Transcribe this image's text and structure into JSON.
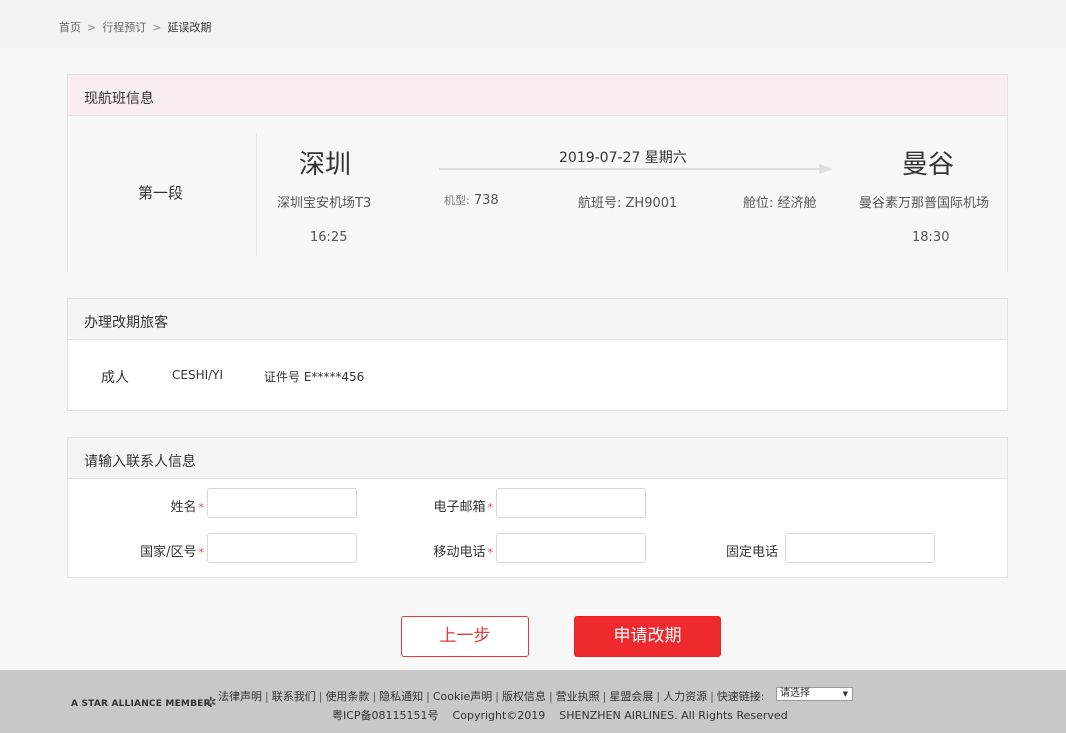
{
  "breadcrumb": {
    "home": "首页",
    "booking": "行程预订",
    "current": "延误改期",
    "sep": ">"
  },
  "flight_section": {
    "title": "现航班信息",
    "segment": "第一段",
    "origin": {
      "city": "深圳",
      "airport": "深圳宝安机场T3",
      "time": "16:25"
    },
    "destination": {
      "city": "曼谷",
      "airport": "曼谷素万那普国际机场",
      "time": "18:30"
    },
    "date": "2019-07-27 星期六",
    "aircraft_label": "机型:",
    "aircraft": "738",
    "flight_no_label": "航班号:",
    "flight_no": "ZH9001",
    "cabin_label": "舱位:",
    "cabin": "经济舱"
  },
  "passenger_section": {
    "title": "办理改期旅客",
    "type": "成人",
    "name": "CESHI/YI",
    "id": "证件号 E*****456"
  },
  "contact_section": {
    "title": "请输入联系人信息",
    "name_label": "姓名",
    "email_label": "电子邮箱",
    "country_label": "国家/区号",
    "mobile_label": "移动电话",
    "landline_label": "固定电话",
    "required_mark": "*"
  },
  "actions": {
    "prev": "上一步",
    "submit": "申请改期"
  },
  "footer": {
    "alliance": "A STAR ALLIANCE MEMBER",
    "links": [
      "法律声明",
      "联系我们",
      "使用条款",
      "隐私通知",
      "Cookie声明",
      "版权信息",
      "营业执照",
      "星盟会展",
      "人力资源",
      "快速链接:"
    ],
    "quick_select": "请选择",
    "icp": "粤ICP备08115151号",
    "copyright": "Copyright©2019",
    "company": "SHENZHEN AIRLINES. All Rights Reserved"
  },
  "colors": {
    "accent_red": "#ee2a2f",
    "required_red": "#e94545"
  }
}
